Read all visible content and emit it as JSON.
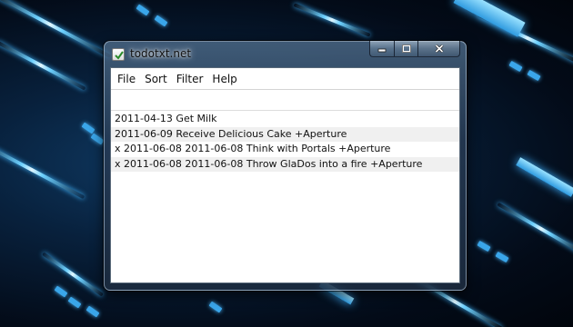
{
  "window": {
    "title": "todotxt.net",
    "controls": {
      "minimize_icon": "minimize-icon",
      "maximize_icon": "maximize-icon",
      "close_icon": "close-icon"
    }
  },
  "menu": {
    "items": [
      {
        "label": "File"
      },
      {
        "label": "Sort"
      },
      {
        "label": "Filter"
      },
      {
        "label": "Help"
      }
    ]
  },
  "filter": {
    "value": ""
  },
  "tasks": [
    {
      "text": "2011-04-13 Get Milk"
    },
    {
      "text": "2011-06-09 Receive Delicious Cake +Aperture"
    },
    {
      "text": "x 2011-06-08 2011-06-08 Think with Portals +Aperture"
    },
    {
      "text": "x 2011-06-08 2011-06-08 Throw GlaDos into a fire +Aperture"
    }
  ],
  "colors": {
    "desktop_accent": "#3aa6ea",
    "window_frame": "#4a6480",
    "alt_row": "#f0f0f0"
  }
}
